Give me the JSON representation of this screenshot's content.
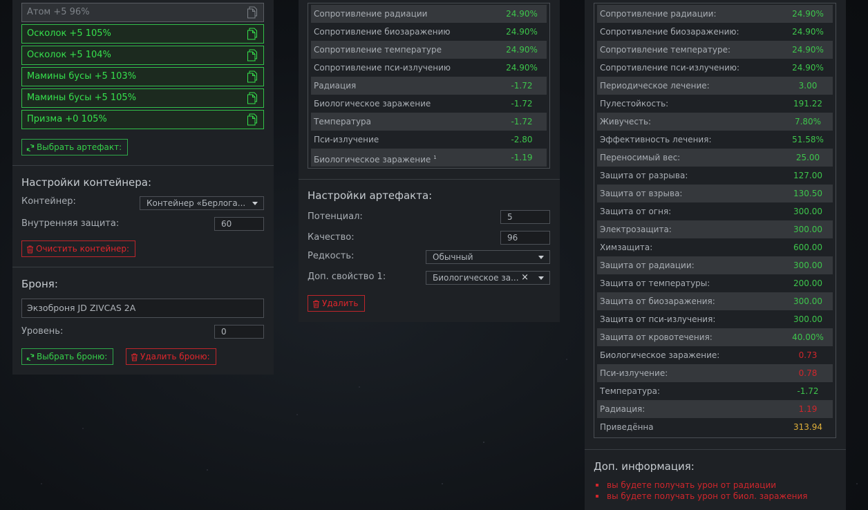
{
  "left": {
    "artifacts": [
      {
        "label": "Атом +5 96%"
      },
      {
        "label": "Осколок +5 105%"
      },
      {
        "label": "Осколок +5 104%"
      },
      {
        "label": "Мамины бусы +5 103%"
      },
      {
        "label": "Мамины бусы +5 105%"
      },
      {
        "label": "Призма +0 105%"
      }
    ],
    "select_artifact_label": "Выбрать артефакт:",
    "container_title": "Настройки контейнера:",
    "container_label": "Контейнер:",
    "container_value": "Контейнер «Берлога...",
    "inner_protection_label": "Внутренняя защита:",
    "inner_protection_value": "60",
    "clear_container_label": "Очистить контейнер:",
    "armor_title": "Броня:",
    "armor_value": "Экзоброня JD ZIVCAS 2A",
    "level_label": "Уровень:",
    "level_value": "0",
    "select_armor_label": "Выбрать броню:",
    "delete_armor_label": "Удалить броню:"
  },
  "middle": {
    "stats": [
      {
        "name": "Сопротивление радиации",
        "value": "24.90%",
        "color": "green"
      },
      {
        "name": "Сопротивление биозаражению",
        "value": "24.90%",
        "color": "green"
      },
      {
        "name": "Сопротивление температуре",
        "value": "24.90%",
        "color": "green"
      },
      {
        "name": "Сопротивление пси-излучению",
        "value": "24.90%",
        "color": "green"
      },
      {
        "name": "Радиация",
        "value": "-1.72",
        "color": "green"
      },
      {
        "name": "Биологическое заражение",
        "value": "-1.72",
        "color": "green"
      },
      {
        "name": "Температура",
        "value": "-1.72",
        "color": "green"
      },
      {
        "name": "Пси-излучение",
        "value": "-2.80",
        "color": "green"
      },
      {
        "name": "Биологическое заражение",
        "sup": "1",
        "value": "-1.19",
        "color": "green"
      }
    ],
    "artifact_settings_title": "Настройки артефакта:",
    "potential_label": "Потенциал:",
    "potential_value": "5",
    "quality_label": "Качество:",
    "quality_value": "96",
    "rarity_label": "Редкость:",
    "rarity_value": "Обычный",
    "extra_prop_label": "Доп. свойство 1:",
    "extra_prop_value": "Биологическое за...",
    "extra_prop_clear": "×",
    "delete_label": "Удалить"
  },
  "right": {
    "stats": [
      {
        "name": "Сопротивление радиации:",
        "value": "24.90%",
        "color": "green"
      },
      {
        "name": "Сопротивление биозаражению:",
        "value": "24.90%",
        "color": "green"
      },
      {
        "name": "Сопротивление температуре:",
        "value": "24.90%",
        "color": "green"
      },
      {
        "name": "Сопротивление пси-излучению:",
        "value": "24.90%",
        "color": "green"
      },
      {
        "name": "Периодическое лечение:",
        "value": "3.00",
        "color": "green"
      },
      {
        "name": "Пулестойкость:",
        "value": "191.22",
        "color": "green"
      },
      {
        "name": "Живучесть:",
        "value": "7.80%",
        "color": "green"
      },
      {
        "name": "Эффективность лечения:",
        "value": "51.58%",
        "color": "green"
      },
      {
        "name": "Переносимый вес:",
        "value": "25.00",
        "color": "green"
      },
      {
        "name": "Защита от разрыва:",
        "value": "127.00",
        "color": "green"
      },
      {
        "name": "Защита от взрыва:",
        "value": "130.50",
        "color": "green"
      },
      {
        "name": "Защита от огня:",
        "value": "300.00",
        "color": "green"
      },
      {
        "name": "Электрозащита:",
        "value": "300.00",
        "color": "green"
      },
      {
        "name": "Химзащита:",
        "value": "600.00",
        "color": "green"
      },
      {
        "name": "Защита от радиации:",
        "value": "300.00",
        "color": "green"
      },
      {
        "name": "Защита от температуры:",
        "value": "200.00",
        "color": "green"
      },
      {
        "name": "Защита от биозаражения:",
        "value": "300.00",
        "color": "green"
      },
      {
        "name": "Защита от пси-излучения:",
        "value": "300.00",
        "color": "green"
      },
      {
        "name": "Защита от кровотечения:",
        "value": "40.00%",
        "color": "green"
      },
      {
        "name": "Биологическое заражение:",
        "value": "0.73",
        "color": "red"
      },
      {
        "name": "Пси-излучение:",
        "value": "0.78",
        "color": "red"
      },
      {
        "name": "Температура:",
        "value": "-1.72",
        "color": "green"
      },
      {
        "name": "Радиация:",
        "value": "1.19",
        "color": "red"
      },
      {
        "name": "Приведённа",
        "value": "313.94",
        "color": "gold"
      }
    ],
    "info_title": "Доп. информация:",
    "info_items": [
      "вы будете получать урон от радиации",
      "вы будете получать урон от биол. заражения"
    ]
  },
  "colors": {
    "green": "#3ec54c",
    "red": "#d1262c",
    "gold": "#e0b03a",
    "panel": "#1e2125"
  }
}
